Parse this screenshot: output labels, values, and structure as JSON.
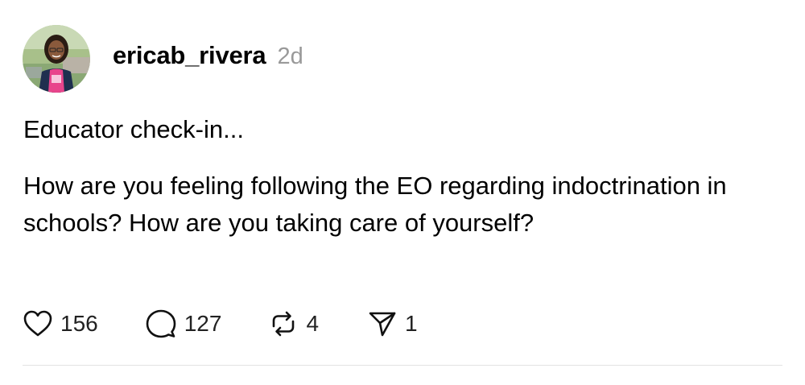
{
  "post": {
    "username": "ericab_rivera",
    "timestamp": "2d",
    "paragraphs": [
      "Educator check-in...",
      "How are you feeling following the EO regarding indoctrination in schools? How are you taking care of yourself?"
    ],
    "actions": {
      "likes": "156",
      "replies": "127",
      "reposts": "4",
      "shares": "1"
    }
  },
  "icons": {
    "like": "heart-icon",
    "reply": "comment-bubble-icon",
    "repost": "repost-arrows-icon",
    "share": "send-paper-plane-icon"
  },
  "colors": {
    "text": "#000000",
    "muted": "#999999",
    "divider": "#e3e3e3",
    "avatar_shirt": "#e8458c",
    "avatar_jacket": "#1f2f4f"
  }
}
